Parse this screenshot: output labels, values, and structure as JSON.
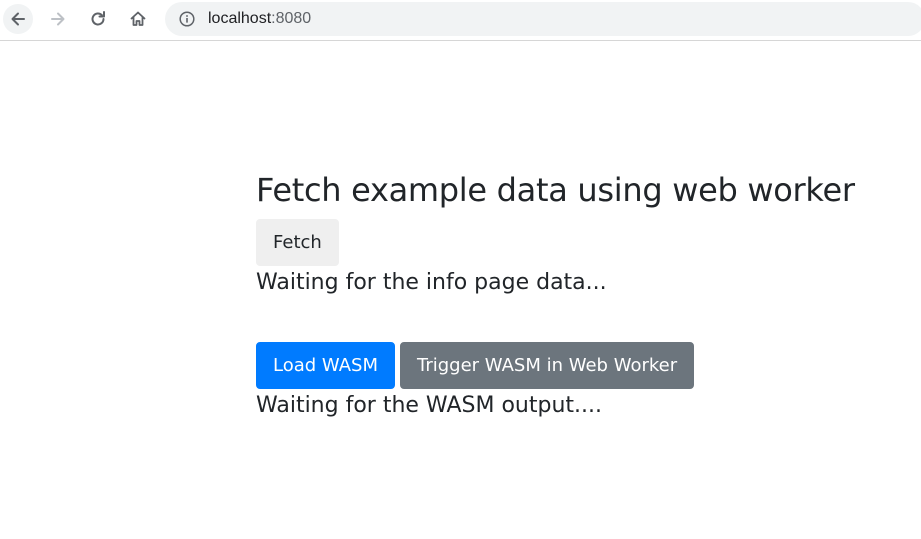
{
  "browser": {
    "url_host": "localhost",
    "url_port": ":8080",
    "icons": {
      "back": "back-arrow-icon",
      "forward": "forward-arrow-icon",
      "reload": "reload-icon",
      "home": "home-icon",
      "site_info": "info-icon"
    }
  },
  "page": {
    "title": "Fetch example data using web worker",
    "fetch_button_label": "Fetch",
    "fetch_status": "Waiting for the info page data...",
    "load_wasm_label": "Load WASM",
    "trigger_wasm_label": "Trigger WASM in Web Worker",
    "wasm_status": "Waiting for the WASM output...."
  },
  "colors": {
    "primary": "#007bff",
    "secondary": "#6c757d",
    "light_button": "#efefef",
    "text": "#212529",
    "omnibox": "#f1f3f4"
  }
}
